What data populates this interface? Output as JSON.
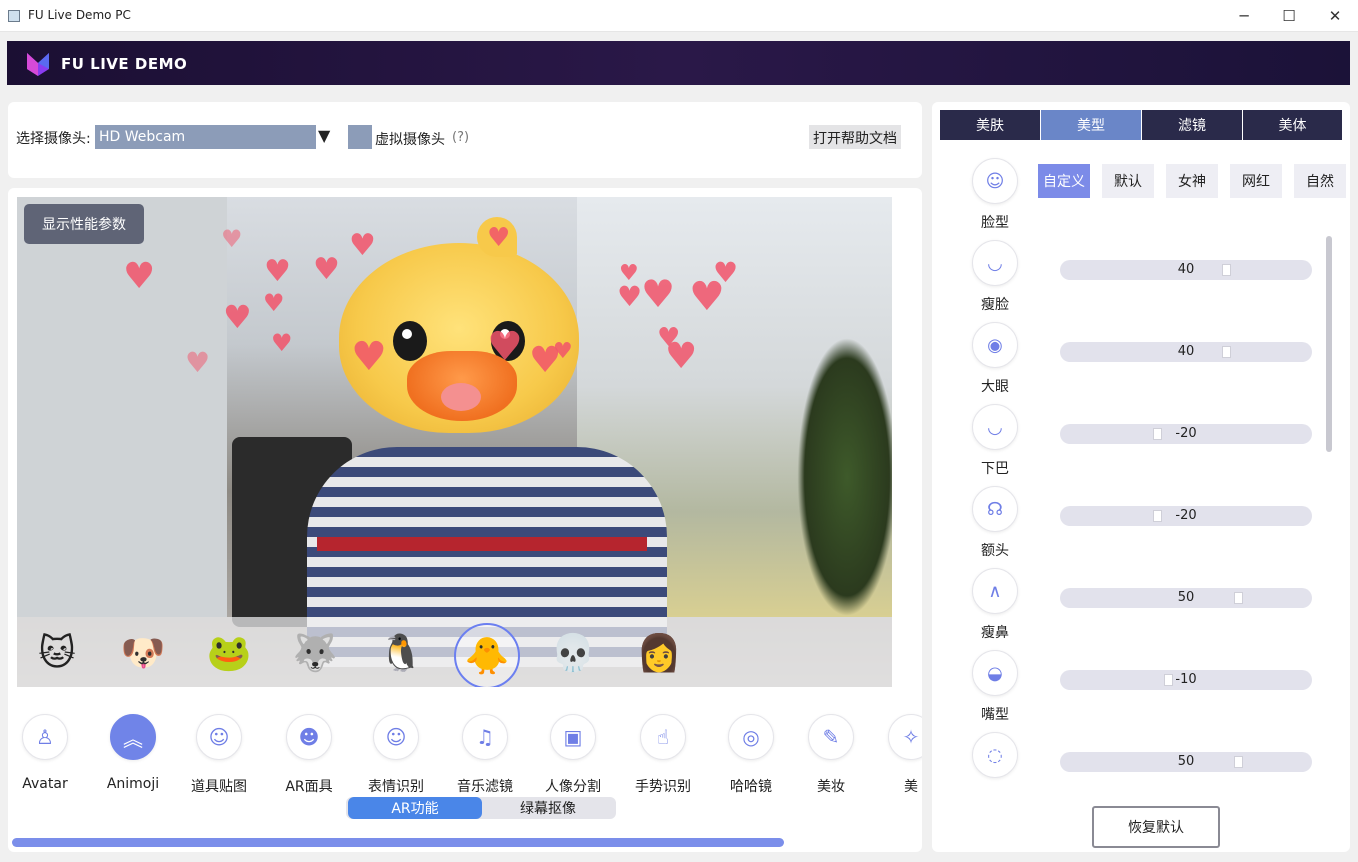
{
  "window": {
    "title": "FU Live Demo PC",
    "minimize": "─",
    "maximize": "☐",
    "close": "✕"
  },
  "header": {
    "brand": "FU LIVE DEMO"
  },
  "camera": {
    "label": "选择摄像头:",
    "selected": "HD Webcam",
    "dropdown_arrow": "▼",
    "virtual_label": "虚拟摄像头",
    "virtual_help": "(?)",
    "help_doc": "打开帮助文档"
  },
  "video": {
    "perf_button": "显示性能参数"
  },
  "stickers": [
    {
      "name": "cat",
      "glyph": "🐱"
    },
    {
      "name": "pug",
      "glyph": "🐶"
    },
    {
      "name": "frog",
      "glyph": "🐸"
    },
    {
      "name": "husky",
      "glyph": "🐺"
    },
    {
      "name": "penguin",
      "glyph": "🐧"
    },
    {
      "name": "duck",
      "glyph": "🐥",
      "selected": true
    },
    {
      "name": "skull",
      "glyph": "💀"
    },
    {
      "name": "girl",
      "glyph": "👩"
    }
  ],
  "features": [
    {
      "label": "Avatar",
      "icon": "avatar-icon",
      "glyph": "♙"
    },
    {
      "label": "Animoji",
      "icon": "chevron-up-icon",
      "glyph": "︽",
      "active": true
    },
    {
      "label": "道具贴图",
      "icon": "cat-face-icon",
      "glyph": "☺"
    },
    {
      "label": "AR面具",
      "icon": "mask-icon",
      "glyph": "☻"
    },
    {
      "label": "表情识别",
      "icon": "smile-icon",
      "glyph": "☺"
    },
    {
      "label": "音乐滤镜",
      "icon": "music-disc-icon",
      "glyph": "♫"
    },
    {
      "label": "人像分割",
      "icon": "portrait-icon",
      "glyph": "▣"
    },
    {
      "label": "手势识别",
      "icon": "thumbs-up-icon",
      "glyph": "☝"
    },
    {
      "label": "哈哈镜",
      "icon": "funhouse-mirror-icon",
      "glyph": "◎"
    },
    {
      "label": "美妆",
      "icon": "makeup-icon",
      "glyph": "✎"
    },
    {
      "label": "美",
      "icon": "more-icon",
      "glyph": "✧"
    }
  ],
  "modes": {
    "ar": "AR功能",
    "green": "绿幕抠像"
  },
  "tabs": [
    {
      "label": "美肤"
    },
    {
      "label": "美型",
      "active": true
    },
    {
      "label": "滤镜"
    },
    {
      "label": "美体"
    }
  ],
  "presets": [
    {
      "label": "自定义",
      "active": true
    },
    {
      "label": "默认"
    },
    {
      "label": "女神"
    },
    {
      "label": "网红"
    },
    {
      "label": "自然"
    }
  ],
  "beauty_items": [
    {
      "label": "脸型",
      "icon": "face-shape-icon",
      "glyph": "☺"
    },
    {
      "label": "瘦脸",
      "icon": "thin-face-icon",
      "glyph": "◡",
      "value": "40",
      "level": 40
    },
    {
      "label": "大眼",
      "icon": "eye-icon",
      "glyph": "◉",
      "value": "40",
      "level": 40
    },
    {
      "label": "下巴",
      "icon": "chin-icon",
      "glyph": "◡",
      "value": "-20",
      "level": -20
    },
    {
      "label": "额头",
      "icon": "forehead-icon",
      "glyph": "☊",
      "value": "-20",
      "level": -20
    },
    {
      "label": "瘦鼻",
      "icon": "nose-icon",
      "glyph": "∧",
      "value": "50",
      "level": 50
    },
    {
      "label": "嘴型",
      "icon": "mouth-icon",
      "glyph": "◒",
      "value": "-10",
      "level": -10
    },
    {
      "label": "",
      "icon": "head-icon",
      "glyph": "◌",
      "value": "50",
      "level": 50
    }
  ],
  "reset": "恢复默认"
}
